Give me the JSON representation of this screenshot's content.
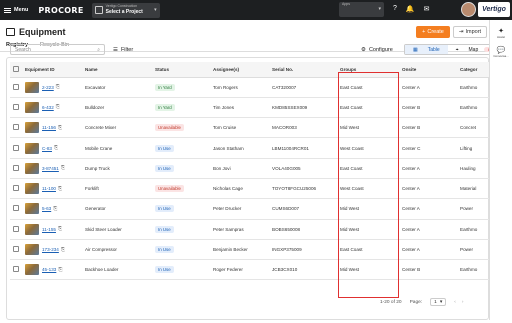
{
  "topbar": {
    "menu_label": "Menu",
    "logo": "PROCORE",
    "project_small": "Vertigo Construction",
    "project_main": "Select a Project",
    "app_small": "Apps",
    "app_main": "Select an App",
    "icons": [
      "help-icon",
      "bell-icon",
      "notifications-icon",
      "account-icon"
    ],
    "brand_logo": "Vertigo"
  },
  "page": {
    "title": "Equipment",
    "create_label": "Create",
    "import_label": "Import",
    "tabs": [
      {
        "label": "Registry"
      },
      {
        "label": "Recycle Bin"
      }
    ]
  },
  "toolbar": {
    "search_placeholder": "Search",
    "filter_label": "Filter",
    "configure_label": "Configure",
    "table_label": "Table",
    "map_label": "Map",
    "beta_label": "Beta"
  },
  "table": {
    "columns": [
      "Equipment ID",
      "Name",
      "Status",
      "Assignee(s)",
      "Serial No.",
      "Groups",
      "Onsite",
      "Categor"
    ],
    "rows": [
      {
        "id": "2-223",
        "name": "Excavator",
        "status": "In Yard",
        "status_type": "inyard",
        "assignee": "Tom Rogers",
        "serial": "CAT320007",
        "group": "East Coast",
        "onsite": "Center A",
        "category": "Earthmo"
      },
      {
        "id": "6-432",
        "name": "Bulldozer",
        "status": "In Yard",
        "status_type": "inyard",
        "assignee": "Tim Jones",
        "serial": "KMD85SSEX009",
        "group": "East Coast",
        "onsite": "Center B",
        "category": "Earthmo"
      },
      {
        "id": "11-156",
        "name": "Concrete Mixer",
        "status": "Unavailable",
        "status_type": "unavail",
        "assignee": "Tom Cruise",
        "serial": "MACOR003",
        "group": "Mid West",
        "onsite": "Center B",
        "category": "Concret"
      },
      {
        "id": "C-83",
        "name": "Mobile Crane",
        "status": "In Use",
        "status_type": "inuse",
        "assignee": "Jason Statham",
        "serial": "LBM11004RCR01",
        "group": "West Coast",
        "onsite": "Center C",
        "category": "Lifting"
      },
      {
        "id": "3-87451",
        "name": "Dump Truck",
        "status": "In Use",
        "status_type": "inuse",
        "assignee": "Bon Jovi",
        "serial": "VOLA40G005",
        "group": "East Coast",
        "onsite": "Center A",
        "category": "Hauling"
      },
      {
        "id": "11-100",
        "name": "Forklift",
        "status": "Unavailable",
        "status_type": "unavail",
        "assignee": "Nicholas Cage",
        "serial": "TOYOT8FGCU25006",
        "group": "West Coast",
        "onsite": "Center A",
        "category": "Material"
      },
      {
        "id": "5-63",
        "name": "Generator",
        "status": "In Use",
        "status_type": "inuse",
        "assignee": "Peter Drucker",
        "serial": "CUMS6D007",
        "group": "Mid West",
        "onsite": "Center A",
        "category": "Power"
      },
      {
        "id": "11-155",
        "name": "Skid Steer Loader",
        "status": "In Use",
        "status_type": "inuse",
        "assignee": "Peter Sampras",
        "serial": "BOBS650008",
        "group": "Mid West",
        "onsite": "Center A",
        "category": "Earthmo"
      },
      {
        "id": "173-234",
        "name": "Air Compressor",
        "status": "In Use",
        "status_type": "inuse",
        "assignee": "Benjamin Becker",
        "serial": "INGXP375009",
        "group": "East Coast",
        "onsite": "Center A",
        "category": "Power"
      },
      {
        "id": "45-133",
        "name": "Backhoe Loader",
        "status": "In Use",
        "status_type": "inuse",
        "assignee": "Roger Federer",
        "serial": "JCB3CX010",
        "group": "Mid West",
        "onsite": "Center B",
        "category": "Earthmo"
      }
    ]
  },
  "pagination": {
    "range_text": "1-20 of 20",
    "page_label": "Page:",
    "page_value": "1"
  },
  "rail": {
    "items": [
      {
        "label": "Assist",
        "icon": "sparkle-icon"
      },
      {
        "label": "Conversa...",
        "icon": "chat-icon"
      }
    ]
  }
}
